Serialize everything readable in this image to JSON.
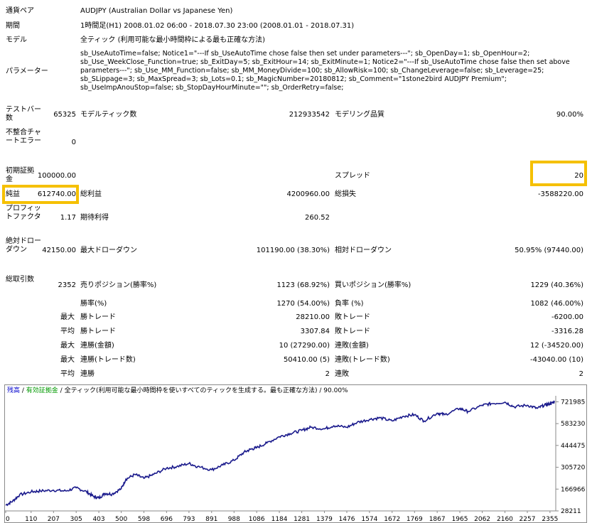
{
  "header": {
    "symbol_label": "通貨ペア",
    "symbol_value": "AUDJPY (Australian Dollar vs Japanese Yen)",
    "period_label": "期間",
    "period_value": "1時間足(H1) 2008.01.02 06:00 - 2018.07.30 23:00 (2008.01.01 - 2018.07.31)",
    "model_label": "モデル",
    "model_value": "全ティック (利用可能な最小時間枠による最も正確な方法)",
    "params_label": "パラメーター",
    "params_value": "sb_UseAutoTime=false; Notice1=\"---If sb_UseAutoTime chose false then set under parameters---\"; sb_OpenDay=1; sb_OpenHour=2; sb_Use_WeekClose_Function=true; sb_ExitDay=5; sb_ExitHour=14; sb_ExitMinute=1; Notice2=\"---If sb_UseAutoTime chose false then set above parameters---\"; sb_Use_MM_Function=false; sb_MM_MoneyDivide=100; sb_AllowRisk=100; sb_ChangeLeverage=false; sb_Leverage=25; sb_SLippage=3; sb_MaxSpread=3; sb_Lots=0.1; sb_MagicNumber=20180812; sb_Comment=\"1stone2bird AUDJPY Premium\"; sb_UseImpAnouStop=false; sb_StopDayHourMinute=\"\"; sb_OrderRetry=false;"
  },
  "stats": {
    "bars_label": "テストバー数",
    "bars_value": "65325",
    "ticks_label": "モデルティック数",
    "ticks_value": "212933542",
    "quality_label": "モデリング品質",
    "quality_value": "90.00%",
    "mismatch_label": "不整合チャートエラー",
    "mismatch_value": "0",
    "deposit_label": "初期証拠金",
    "deposit_value": "100000.00",
    "spread_label": "スプレッド",
    "spread_value": "20",
    "net_label": "純益",
    "net_value": "612740.00",
    "gross_profit_label": "総利益",
    "gross_profit_value": "4200960.00",
    "gross_loss_label": "総損失",
    "gross_loss_value": "-3588220.00",
    "pf_label": "プロフィットファクタ",
    "pf_value": "1.17",
    "expected_label": "期待利得",
    "expected_value": "260.52",
    "abs_dd_label": "絶対ドローダウン",
    "abs_dd_value": "42150.00",
    "max_dd_label": "最大ドローダウン",
    "max_dd_value": "101190.00 (38.30%)",
    "rel_dd_label": "相対ドローダウン",
    "rel_dd_value": "50.95% (97440.00)",
    "total_trades_label": "総取引数",
    "total_trades_value": "2352",
    "short_label": "売りポジション(勝率%)",
    "short_value": "1123 (68.92%)",
    "long_label": "買いポジション(勝率%)",
    "long_value": "1229 (40.36%)",
    "win_rate_label": "勝率(%)",
    "win_rate_value": "1270 (54.00%)",
    "loss_rate_label": "負率 (%)",
    "loss_rate_value": "1082 (46.00%)",
    "max_label": "最大",
    "largest_win_label": "勝トレード",
    "largest_win_value": "28210.00",
    "largest_loss_label": "敗トレード",
    "largest_loss_value": "-6200.00",
    "avg_label": "平均",
    "avg_win_label": "勝トレード",
    "avg_win_value": "3307.84",
    "avg_loss_label": "敗トレード",
    "avg_loss_value": "-3316.28",
    "max2_label": "最大",
    "consec_win_money_label": "連勝(金額)",
    "consec_win_money_value": "10 (27290.00)",
    "consec_loss_money_label": "連敗(金額)",
    "consec_loss_money_value": "12 (-34520.00)",
    "max3_label": "最大",
    "consec_win_trades_label": "連勝(トレード数)",
    "consec_win_trades_value": "50410.00 (5)",
    "consec_loss_trades_label": "連敗(トレード数)",
    "consec_loss_trades_value": "-43040.00 (10)",
    "avg2_label": "平均",
    "avg_consec_win_label": "連勝",
    "avg_consec_win_value": "2",
    "avg_consec_loss_label": "連敗",
    "avg_consec_loss_value": "2"
  },
  "chart_legend": {
    "balance": "残高",
    "sep1": " / ",
    "equity": "有効証拠金",
    "sep2": " / ",
    "desc": "全ティック(利用可能な最小時間枠を使いすべてのティックを生成する。最も正確な方法)",
    "sep3": " / ",
    "quality": "90.00%"
  },
  "colors": {
    "line": "#1a1a8c",
    "balance_text": "#0000cc",
    "equity_text": "#009900",
    "highlight": "#f5c000",
    "chart_border": "#8a8a8a"
  },
  "chart_data": {
    "type": "line",
    "title": "",
    "xlabel": "",
    "ylabel": "",
    "x_ticks": [
      0,
      110,
      207,
      305,
      403,
      500,
      598,
      696,
      793,
      891,
      988,
      1086,
      1184,
      1281,
      1379,
      1476,
      1574,
      1672,
      1769,
      1867,
      1965,
      2062,
      2160,
      2257,
      2355
    ],
    "y_ticks": [
      28211,
      166966,
      305720,
      444475,
      583230,
      721985
    ],
    "xlim": [
      0,
      2380
    ],
    "ylim": [
      28211,
      760000
    ],
    "series": [
      {
        "x": [
          0,
          30,
          60,
          110,
          150,
          207,
          260,
          305,
          350,
          380,
          403,
          430,
          460,
          500,
          520,
          560,
          598,
          640,
          696,
          740,
          793,
          830,
          891,
          940,
          988,
          1030,
          1060,
          1086,
          1130,
          1184,
          1230,
          1281,
          1320,
          1379,
          1420,
          1476,
          1520,
          1574,
          1620,
          1672,
          1720,
          1769,
          1810,
          1867,
          1900,
          1965,
          2000,
          2062,
          2100,
          2160,
          2200,
          2257,
          2300,
          2330,
          2355,
          2375
        ],
        "values": [
          65000,
          90000,
          130000,
          150000,
          155000,
          160000,
          155000,
          175000,
          150000,
          120000,
          110000,
          140000,
          135000,
          170000,
          230000,
          260000,
          235000,
          260000,
          300000,
          310000,
          330000,
          310000,
          290000,
          320000,
          350000,
          400000,
          420000,
          430000,
          460000,
          500000,
          520000,
          540000,
          560000,
          550000,
          570000,
          560000,
          590000,
          610000,
          620000,
          600000,
          630000,
          640000,
          600000,
          650000,
          640000,
          680000,
          660000,
          700000,
          710000,
          720000,
          690000,
          700000,
          680000,
          700000,
          710000,
          720000
        ]
      }
    ]
  }
}
